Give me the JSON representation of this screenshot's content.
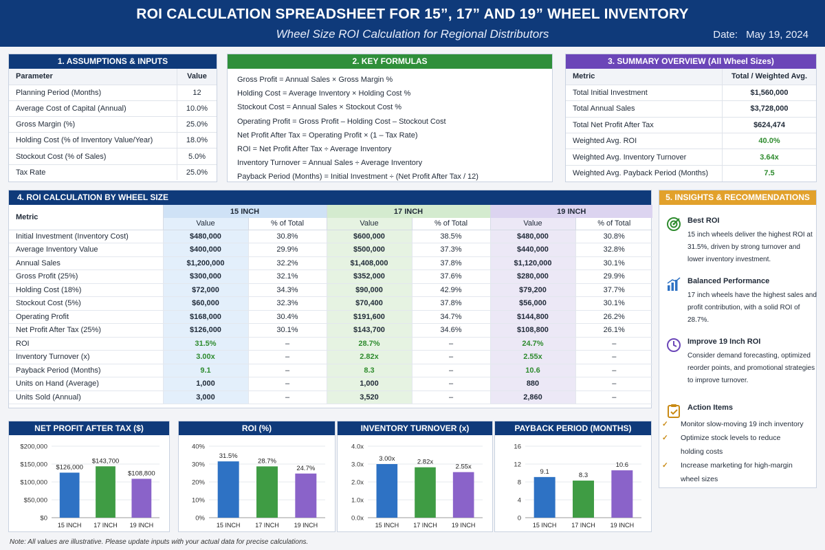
{
  "header": {
    "title": "ROI CALCULATION SPREADSHEET FOR 15”, 17” AND 19” WHEEL INVENTORY",
    "subtitle": "Wheel Size ROI Calculation for Regional Distributors",
    "date_label": "Date:",
    "date_value": "May 19, 2024"
  },
  "assumptions": {
    "title": "1. ASSUMPTIONS & INPUTS",
    "col_param": "Parameter",
    "col_value": "Value",
    "rows": [
      {
        "label": "Planning Period (Months)",
        "value": "12"
      },
      {
        "label": "Average Cost of Capital (Annual)",
        "value": "10.0%"
      },
      {
        "label": "Gross Margin (%)",
        "value": "25.0%"
      },
      {
        "label": "Holding Cost (% of Inventory Value/Year)",
        "value": "18.0%"
      },
      {
        "label": "Stockout Cost (% of Sales)",
        "value": "5.0%"
      },
      {
        "label": "Tax Rate",
        "value": "25.0%"
      }
    ]
  },
  "formulas": {
    "title": "2. KEY FORMULAS",
    "items": [
      "Gross Profit = Annual Sales × Gross Margin %",
      "Holding Cost = Average Inventory × Holding Cost %",
      "Stockout Cost = Annual Sales × Stockout Cost %",
      "Operating Profit = Gross Profit – Holding Cost – Stockout Cost",
      "Net Profit After Tax = Operating Profit × (1 – Tax Rate)",
      "ROI = Net Profit After Tax ÷ Average Inventory",
      "Inventory Turnover = Annual Sales ÷ Average Inventory",
      "Payback Period (Months) = Initial Investment ÷ (Net Profit After Tax / 12)"
    ]
  },
  "summary": {
    "title": "3. SUMMARY OVERVIEW (All Wheel Sizes)",
    "col_metric": "Metric",
    "col_value": "Total / Weighted Avg.",
    "rows": [
      {
        "label": "Total Initial Investment",
        "value": "$1,560,000"
      },
      {
        "label": "Total Annual Sales",
        "value": "$3,728,000"
      },
      {
        "label": "Total Net Profit After Tax",
        "value": "$624,474"
      },
      {
        "label": "Weighted Avg. ROI",
        "value": "40.0%"
      },
      {
        "label": "Weighted Avg. Inventory Turnover",
        "value": "3.64x"
      },
      {
        "label": "Weighted Avg. Payback Period (Months)",
        "value": "7.5"
      }
    ]
  },
  "roi_table": {
    "title": "4. ROI CALCULATION BY WHEEL SIZE",
    "metric_header": "Metric",
    "groups": [
      "15 INCH",
      "17 INCH",
      "19 INCH"
    ],
    "sub_value": "Value",
    "sub_pct": "% of Total",
    "rows": [
      {
        "label": "Initial Investment (Inventory Cost)",
        "cells": [
          "$480,000",
          "30.8%",
          "$600,000",
          "38.5%",
          "$480,000",
          "30.8%"
        ]
      },
      {
        "label": "Average Inventory Value",
        "cells": [
          "$400,000",
          "29.9%",
          "$500,000",
          "37.3%",
          "$440,000",
          "32.8%"
        ]
      },
      {
        "label": "Annual Sales",
        "cells": [
          "$1,200,000",
          "32.2%",
          "$1,408,000",
          "37.8%",
          "$1,120,000",
          "30.1%"
        ]
      },
      {
        "label": "Gross Profit (25%)",
        "cells": [
          "$300,000",
          "32.1%",
          "$352,000",
          "37.6%",
          "$280,000",
          "29.9%"
        ]
      },
      {
        "label": "Holding Cost (18%)",
        "cells": [
          "$72,000",
          "34.3%",
          "$90,000",
          "42.9%",
          "$79,200",
          "37.7%"
        ]
      },
      {
        "label": "Stockout Cost (5%)",
        "cells": [
          "$60,000",
          "32.3%",
          "$70,400",
          "37.8%",
          "$56,000",
          "30.1%"
        ]
      },
      {
        "label": "Operating Profit",
        "cells": [
          "$168,000",
          "30.4%",
          "$191,600",
          "34.7%",
          "$144,800",
          "26.2%"
        ]
      },
      {
        "label": "Net Profit After Tax (25%)",
        "cells": [
          "$126,000",
          "30.1%",
          "$143,700",
          "34.6%",
          "$108,800",
          "26.1%"
        ]
      },
      {
        "label": "ROI",
        "cells": [
          "31.5%",
          "–",
          "28.7%",
          "–",
          "24.7%",
          "–"
        ],
        "style": "green"
      },
      {
        "label": "Inventory Turnover (x)",
        "cells": [
          "3.00x",
          "–",
          "2.82x",
          "–",
          "2.55x",
          "–"
        ],
        "style": "green"
      },
      {
        "label": "Payback Period (Months)",
        "cells": [
          "9.1",
          "–",
          "8.3",
          "–",
          "10.6",
          "–"
        ],
        "style": "green"
      },
      {
        "label": "Units on Hand (Average)",
        "cells": [
          "1,000",
          "–",
          "1,000",
          "–",
          "880",
          "–"
        ],
        "style": "bold"
      },
      {
        "label": "Units Sold (Annual)",
        "cells": [
          "3,000",
          "–",
          "3,520",
          "–",
          "2,860",
          "–"
        ],
        "style": "bold"
      }
    ]
  },
  "insights": {
    "title": "5. INSIGHTS & RECOMMENDATIONS",
    "best_roi": {
      "heading": "Best ROI",
      "body": "15 inch wheels deliver the highest ROI at 31.5%, driven by strong turnover and lower inventory investment."
    },
    "balanced": {
      "heading": "Balanced Performance",
      "body": "17 inch wheels have the highest sales and profit contribution, with a solid ROI of 28.7%."
    },
    "improve": {
      "heading": "Improve 19 Inch ROI",
      "body": "Consider demand forecasting, optimized reorder points, and promotional strategies to improve turnover."
    },
    "actions": {
      "heading": "Action Items",
      "items": [
        "Monitor slow-moving 19 inch inventory",
        "Optimize stock levels to reduce",
        "holding costs",
        "Increase marketing for high-margin",
        "wheel sizes"
      ],
      "checked": [
        true,
        true,
        false,
        true,
        false
      ]
    }
  },
  "chart_data": [
    {
      "type": "bar",
      "title": "NET PROFIT AFTER TAX ($)",
      "categories": [
        "15 INCH",
        "17 INCH",
        "19 INCH"
      ],
      "values": [
        126000,
        143700,
        108800
      ],
      "value_labels": [
        "$126,000",
        "$143,700",
        "$108,800"
      ],
      "ylim": [
        0,
        200000
      ],
      "yticks": [
        "$0",
        "$50,000",
        "$100,000",
        "$150,000",
        "$200,000"
      ],
      "colors": [
        "#2e72c4",
        "#3f9c44",
        "#8a63c9"
      ]
    },
    {
      "type": "bar",
      "title": "ROI (%)",
      "categories": [
        "15 INCH",
        "17 INCH",
        "19 INCH"
      ],
      "values": [
        31.5,
        28.7,
        24.7
      ],
      "value_labels": [
        "31.5%",
        "28.7%",
        "24.7%"
      ],
      "ylim": [
        0,
        40
      ],
      "yticks": [
        "0%",
        "10%",
        "20%",
        "30%",
        "40%"
      ],
      "colors": [
        "#2e72c4",
        "#3f9c44",
        "#8a63c9"
      ]
    },
    {
      "type": "bar",
      "title": "INVENTORY TURNOVER (x)",
      "categories": [
        "15 INCH",
        "17 INCH",
        "19 INCH"
      ],
      "values": [
        3.0,
        2.82,
        2.55
      ],
      "value_labels": [
        "3.00x",
        "2.82x",
        "2.55x"
      ],
      "ylim": [
        0,
        4
      ],
      "yticks": [
        "0.0x",
        "1.0x",
        "2.0x",
        "3.0x",
        "4.0x"
      ],
      "colors": [
        "#2e72c4",
        "#3f9c44",
        "#8a63c9"
      ]
    },
    {
      "type": "bar",
      "title": "PAYBACK PERIOD (MONTHS)",
      "categories": [
        "15 INCH",
        "17 INCH",
        "19 INCH"
      ],
      "values": [
        9.1,
        8.3,
        10.6
      ],
      "value_labels": [
        "9.1",
        "8.3",
        "10.6"
      ],
      "ylim": [
        0,
        16
      ],
      "yticks": [
        "0",
        "4",
        "8",
        "12",
        "16"
      ],
      "colors": [
        "#2e72c4",
        "#3f9c44",
        "#8a63c9"
      ]
    }
  ],
  "footer": "Note: All values are illustrative. Please update inputs with your actual data for precise calculations."
}
